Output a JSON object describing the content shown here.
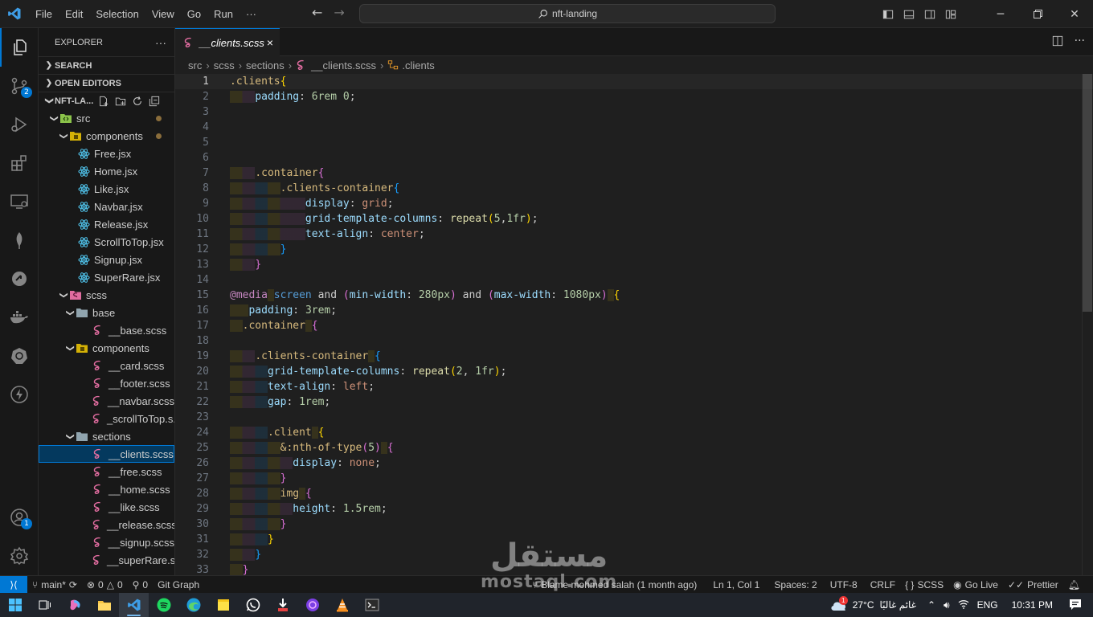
{
  "menu": [
    "File",
    "Edit",
    "Selection",
    "View",
    "Go",
    "Run",
    "···"
  ],
  "search": {
    "label": "nft-landing"
  },
  "activity": {
    "scm_badge": "2",
    "accounts_badge": "1"
  },
  "sidebar": {
    "title": "EXPLORER",
    "more": "···",
    "sections": {
      "search": "SEARCH",
      "open_editors": "OPEN EDITORS",
      "project": "NFT-LA..."
    },
    "tree": [
      {
        "label": "src",
        "depth": 1,
        "kind": "folder-src",
        "twisty": "open",
        "dot": true
      },
      {
        "label": "components",
        "depth": 2,
        "kind": "folder-comp",
        "twisty": "open",
        "dot": true
      },
      {
        "label": "Free.jsx",
        "depth": 3,
        "kind": "react"
      },
      {
        "label": "Home.jsx",
        "depth": 3,
        "kind": "react"
      },
      {
        "label": "Like.jsx",
        "depth": 3,
        "kind": "react"
      },
      {
        "label": "Navbar.jsx",
        "depth": 3,
        "kind": "react"
      },
      {
        "label": "Release.jsx",
        "depth": 3,
        "kind": "react"
      },
      {
        "label": "ScrollToTop.jsx",
        "depth": 3,
        "kind": "react"
      },
      {
        "label": "Signup.jsx",
        "depth": 3,
        "kind": "react"
      },
      {
        "label": "SuperRare.jsx",
        "depth": 3,
        "kind": "react"
      },
      {
        "label": "scss",
        "depth": 2,
        "kind": "folder-scss",
        "twisty": "open"
      },
      {
        "label": "base",
        "depth": 3,
        "kind": "folder",
        "twisty": "open"
      },
      {
        "label": "__base.scss",
        "depth": 4,
        "kind": "sass"
      },
      {
        "label": "components",
        "depth": 3,
        "kind": "folder-comp",
        "twisty": "open"
      },
      {
        "label": "__card.scss",
        "depth": 4,
        "kind": "sass"
      },
      {
        "label": "__footer.scss",
        "depth": 4,
        "kind": "sass"
      },
      {
        "label": "__navbar.scss",
        "depth": 4,
        "kind": "sass"
      },
      {
        "label": "_scrollToTop.s...",
        "depth": 4,
        "kind": "sass"
      },
      {
        "label": "sections",
        "depth": 3,
        "kind": "folder",
        "twisty": "open"
      },
      {
        "label": "__clients.scss",
        "depth": 4,
        "kind": "sass",
        "selected": true
      },
      {
        "label": "__free.scss",
        "depth": 4,
        "kind": "sass"
      },
      {
        "label": "__home.scss",
        "depth": 4,
        "kind": "sass"
      },
      {
        "label": "__like.scss",
        "depth": 4,
        "kind": "sass"
      },
      {
        "label": "__release.scss",
        "depth": 4,
        "kind": "sass"
      },
      {
        "label": "__signup.scss",
        "depth": 4,
        "kind": "sass"
      },
      {
        "label": "__superRare.s...",
        "depth": 4,
        "kind": "sass"
      }
    ]
  },
  "tab": {
    "label": "__clients.scss",
    "close": "×"
  },
  "breadcrumb": {
    "src": "src",
    "scss": "scss",
    "sections": "sections",
    "file": "__clients.scss",
    "symbol": ".clients"
  },
  "editor": {
    "current_line": 1,
    "lines": [
      {
        "n": "1",
        "tokens": [
          [
            ".clients",
            "sel"
          ],
          [
            "{",
            "b1"
          ]
        ]
      },
      {
        "n": "2",
        "tokens": [
          [
            "    ",
            ""
          ],
          [
            "padding",
            "prop"
          ],
          [
            ": ",
            "p"
          ],
          [
            "6rem 0",
            "num"
          ],
          [
            ";",
            "p"
          ]
        ]
      },
      {
        "n": "3",
        "tokens": []
      },
      {
        "n": "4",
        "tokens": []
      },
      {
        "n": "5",
        "tokens": []
      },
      {
        "n": "6",
        "tokens": []
      },
      {
        "n": "7",
        "tokens": [
          [
            "    ",
            ""
          ],
          [
            ".container",
            "sel"
          ],
          [
            "{",
            "b2"
          ]
        ]
      },
      {
        "n": "8",
        "tokens": [
          [
            "        ",
            ""
          ],
          [
            ".clients-container",
            "sel"
          ],
          [
            "{",
            "b3"
          ]
        ]
      },
      {
        "n": "9",
        "tokens": [
          [
            "            ",
            ""
          ],
          [
            "display",
            "prop"
          ],
          [
            ": ",
            "p"
          ],
          [
            "grid",
            "val"
          ],
          [
            ";",
            "p"
          ]
        ]
      },
      {
        "n": "10",
        "tokens": [
          [
            "            ",
            ""
          ],
          [
            "grid-template-columns",
            "prop"
          ],
          [
            ": ",
            "p"
          ],
          [
            "repeat",
            "fn"
          ],
          [
            "(",
            "b1"
          ],
          [
            "5",
            "num"
          ],
          [
            ",",
            "p"
          ],
          [
            "1fr",
            "num"
          ],
          [
            ")",
            "b1"
          ],
          [
            ";",
            "p"
          ]
        ]
      },
      {
        "n": "11",
        "tokens": [
          [
            "            ",
            ""
          ],
          [
            "text-align",
            "prop"
          ],
          [
            ": ",
            "p"
          ],
          [
            "center",
            "val"
          ],
          [
            ";",
            "p"
          ]
        ]
      },
      {
        "n": "12",
        "tokens": [
          [
            "        ",
            ""
          ],
          [
            "}",
            "b3"
          ]
        ]
      },
      {
        "n": "13",
        "tokens": [
          [
            "    ",
            ""
          ],
          [
            "}",
            "b2"
          ]
        ]
      },
      {
        "n": "14",
        "tokens": []
      },
      {
        "n": "15",
        "tokens": [
          [
            "@media",
            "at"
          ],
          [
            " ",
            "p"
          ],
          [
            "screen",
            "kw"
          ],
          [
            " and ",
            "p"
          ],
          [
            "(",
            "b2"
          ],
          [
            "min-width",
            "prop"
          ],
          [
            ": ",
            "p"
          ],
          [
            "280px",
            "num"
          ],
          [
            ")",
            "b2"
          ],
          [
            " and ",
            "p"
          ],
          [
            "(",
            "b2"
          ],
          [
            "max-width",
            "prop"
          ],
          [
            ": ",
            "p"
          ],
          [
            "1080px",
            "num"
          ],
          [
            ")",
            "b2"
          ],
          [
            " ",
            "p"
          ],
          [
            "{",
            "b1"
          ]
        ]
      },
      {
        "n": "16",
        "tokens": [
          [
            "   ",
            ""
          ],
          [
            "padding",
            "prop"
          ],
          [
            ": ",
            "p"
          ],
          [
            "3rem",
            "num"
          ],
          [
            ";",
            "p"
          ]
        ]
      },
      {
        "n": "17",
        "tokens": [
          [
            "  ",
            ""
          ],
          [
            ".container",
            "sel"
          ],
          [
            " ",
            "p"
          ],
          [
            "{",
            "b2"
          ]
        ]
      },
      {
        "n": "18",
        "tokens": []
      },
      {
        "n": "19",
        "tokens": [
          [
            "    ",
            ""
          ],
          [
            ".clients-container",
            "sel"
          ],
          [
            " ",
            "p"
          ],
          [
            "{",
            "b3"
          ]
        ]
      },
      {
        "n": "20",
        "tokens": [
          [
            "      ",
            ""
          ],
          [
            "grid-template-columns",
            "prop"
          ],
          [
            ": ",
            "p"
          ],
          [
            "repeat",
            "fn"
          ],
          [
            "(",
            "b1"
          ],
          [
            "2",
            "num"
          ],
          [
            ", ",
            "p"
          ],
          [
            "1fr",
            "num"
          ],
          [
            ")",
            "b1"
          ],
          [
            ";",
            "p"
          ]
        ]
      },
      {
        "n": "21",
        "tokens": [
          [
            "      ",
            ""
          ],
          [
            "text-align",
            "prop"
          ],
          [
            ": ",
            "p"
          ],
          [
            "left",
            "val"
          ],
          [
            ";",
            "p"
          ]
        ]
      },
      {
        "n": "22",
        "tokens": [
          [
            "      ",
            ""
          ],
          [
            "gap",
            "prop"
          ],
          [
            ": ",
            "p"
          ],
          [
            "1rem",
            "num"
          ],
          [
            ";",
            "p"
          ]
        ]
      },
      {
        "n": "23",
        "tokens": []
      },
      {
        "n": "24",
        "tokens": [
          [
            "      ",
            ""
          ],
          [
            ".client",
            "sel"
          ],
          [
            " ",
            "p"
          ],
          [
            "{",
            "b1"
          ]
        ]
      },
      {
        "n": "25",
        "tokens": [
          [
            "        ",
            ""
          ],
          [
            "&:nth-of-type",
            "sel"
          ],
          [
            "(",
            "b2"
          ],
          [
            "5",
            "num"
          ],
          [
            ")",
            "b2"
          ],
          [
            " ",
            "p"
          ],
          [
            "{",
            "b2"
          ]
        ]
      },
      {
        "n": "26",
        "tokens": [
          [
            "          ",
            ""
          ],
          [
            "display",
            "prop"
          ],
          [
            ": ",
            "p"
          ],
          [
            "none",
            "val"
          ],
          [
            ";",
            "p"
          ]
        ]
      },
      {
        "n": "27",
        "tokens": [
          [
            "        ",
            ""
          ],
          [
            "}",
            "b2"
          ]
        ]
      },
      {
        "n": "28",
        "tokens": [
          [
            "        ",
            ""
          ],
          [
            "img",
            "tag"
          ],
          [
            " ",
            "p"
          ],
          [
            "{",
            "b2"
          ]
        ]
      },
      {
        "n": "29",
        "tokens": [
          [
            "          ",
            ""
          ],
          [
            "height",
            "prop"
          ],
          [
            ": ",
            "p"
          ],
          [
            "1.5rem",
            "num"
          ],
          [
            ";",
            "p"
          ]
        ]
      },
      {
        "n": "30",
        "tokens": [
          [
            "        ",
            ""
          ],
          [
            "}",
            "b2"
          ]
        ]
      },
      {
        "n": "31",
        "tokens": [
          [
            "      ",
            ""
          ],
          [
            "}",
            "b1"
          ]
        ]
      },
      {
        "n": "32",
        "tokens": [
          [
            "    ",
            ""
          ],
          [
            "}",
            "b3"
          ]
        ]
      },
      {
        "n": "33",
        "tokens": [
          [
            "  ",
            ""
          ],
          [
            "}",
            "b2"
          ]
        ]
      }
    ]
  },
  "status": {
    "branch": "main*",
    "errors": "0",
    "warnings": "0",
    "ports": "0",
    "git_graph": "Git Graph",
    "blame": "Blame mohmed salah (1 month ago)",
    "position": "Ln 1, Col 1",
    "spaces": "Spaces: 2",
    "encoding": "UTF-8",
    "eol": "CRLF",
    "language": "SCSS",
    "golive": "Go Live",
    "prettier": "Prettier"
  },
  "taskbar": {
    "temp": "27°C",
    "weather": "غائم غالبًا",
    "lang": "ENG",
    "time": "10:31 PM",
    "weather_badge": "1"
  },
  "watermark": {
    "arabic": "مستقل",
    "latin": "mostaql.com"
  },
  "colors": {
    "accent": "#0078d4",
    "sel": "#d7ba7d",
    "prop": "#9cdcfe",
    "num": "#b5cea8",
    "val": "#ce9178",
    "fn": "#dcdcaa",
    "b1": "#ffd700",
    "b2": "#da70d6",
    "b3": "#179fff",
    "at": "#c586c0",
    "kw": "#569cd6",
    "sass": "#e06c9f",
    "react": "#4fc1e9"
  }
}
